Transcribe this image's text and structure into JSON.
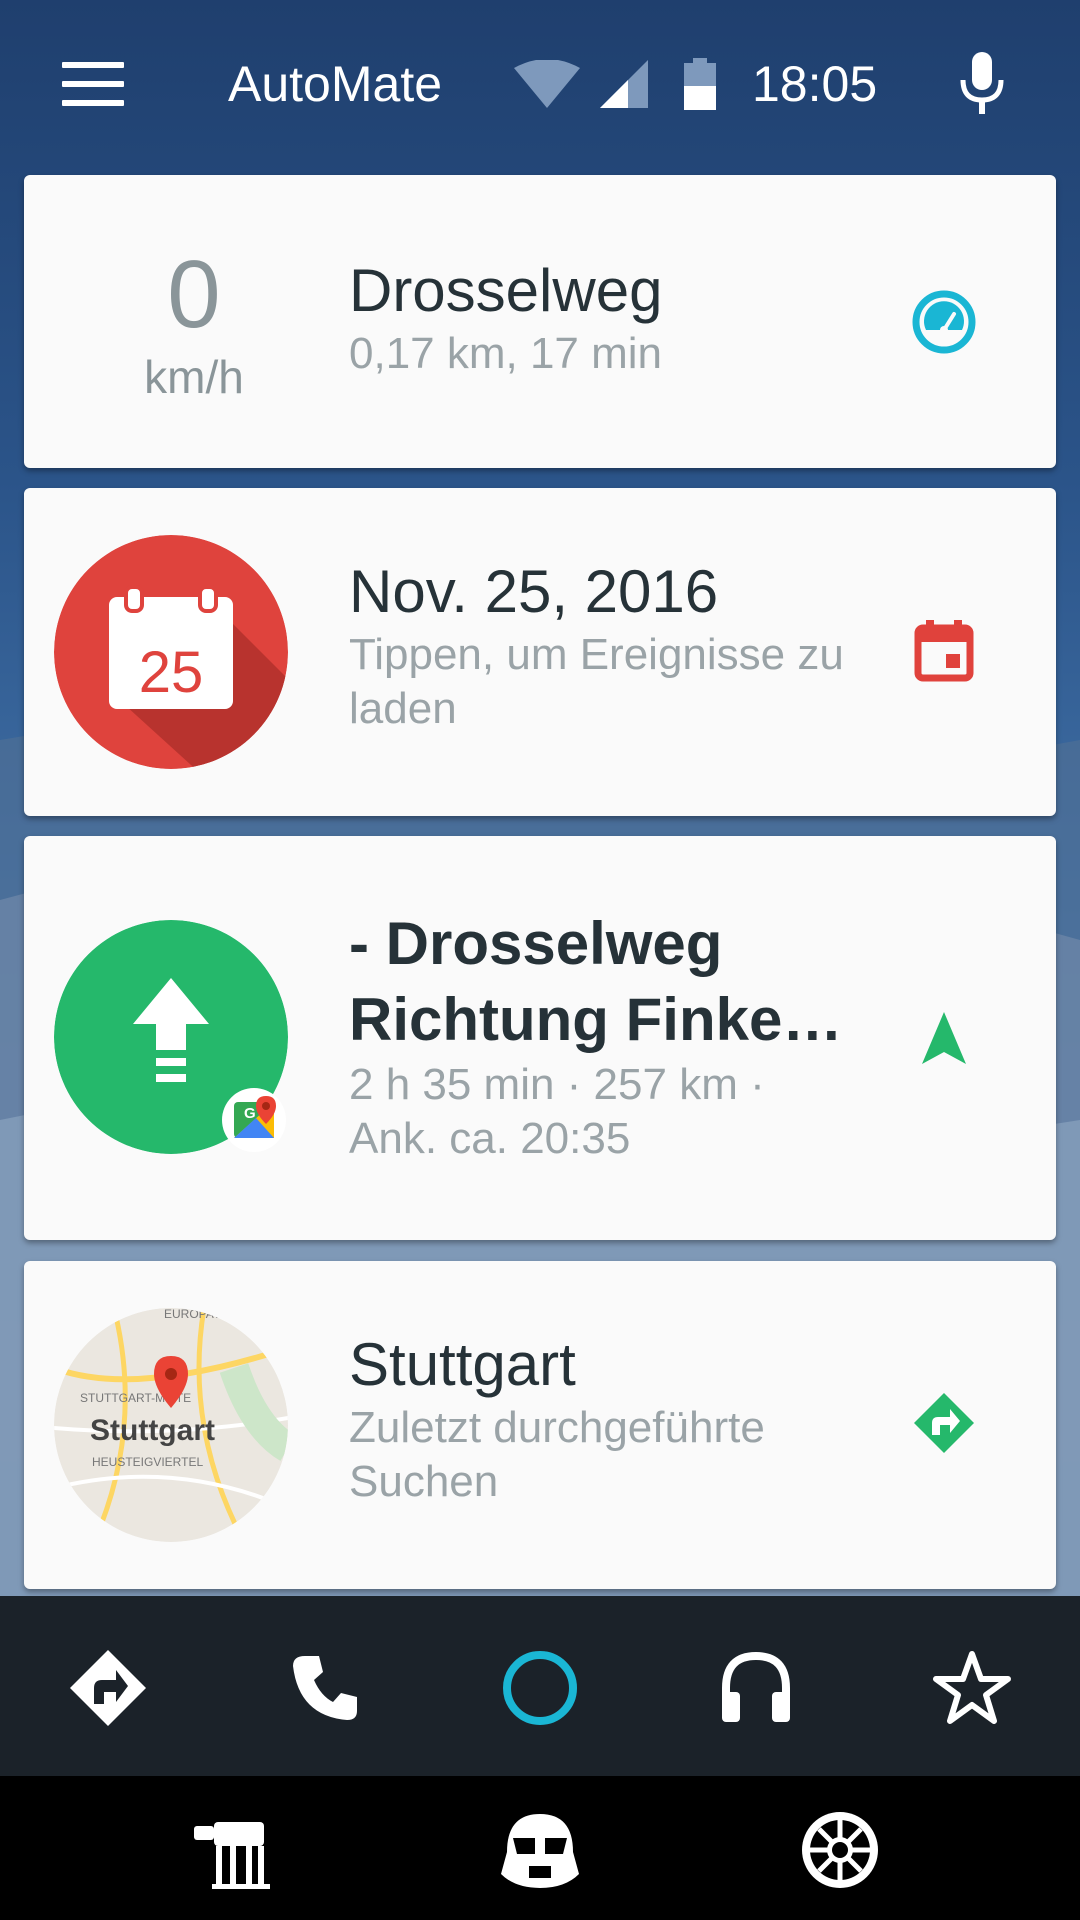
{
  "status": {
    "app_title": "AutoMate",
    "time": "18:05"
  },
  "cards": {
    "speed": {
      "value": "0",
      "unit": "km/h",
      "title": "Drosselweg",
      "subtitle": "0,17 km, 17 min",
      "action_icon": "speedometer-icon",
      "accent": "#1ab6d4"
    },
    "calendar": {
      "day": "25",
      "title": "Nov. 25, 2016",
      "subtitle": "Tippen, um Ereignisse zu laden",
      "action_icon": "calendar-icon",
      "accent": "#e0423c"
    },
    "navigation": {
      "title": "- Drosselweg Richtung Finke…",
      "subtitle_line1": "2 h 35 min · 257 km ·",
      "subtitle_line2": "Ank. ca. 20:35",
      "action_icon": "navigation-arrow-icon",
      "accent": "#25b86b"
    },
    "search": {
      "map_label": "Stuttgart",
      "map_district1": "STUTTGART-MITTE",
      "map_district2": "HEUSTEIGVIERTEL",
      "map_district3": "EUROPAVIERTEL",
      "title": "Stuttgart",
      "subtitle": "Zuletzt durchgeführte Suchen",
      "action_icon": "directions-icon",
      "accent": "#25b86b"
    }
  },
  "bottom_bar": [
    "directions-icon",
    "phone-icon",
    "assistant-circle-icon",
    "headphones-icon",
    "star-icon"
  ],
  "theme_bar": [
    "at-at-walker-icon",
    "stormtrooper-helmet-icon",
    "galactic-empire-icon"
  ]
}
